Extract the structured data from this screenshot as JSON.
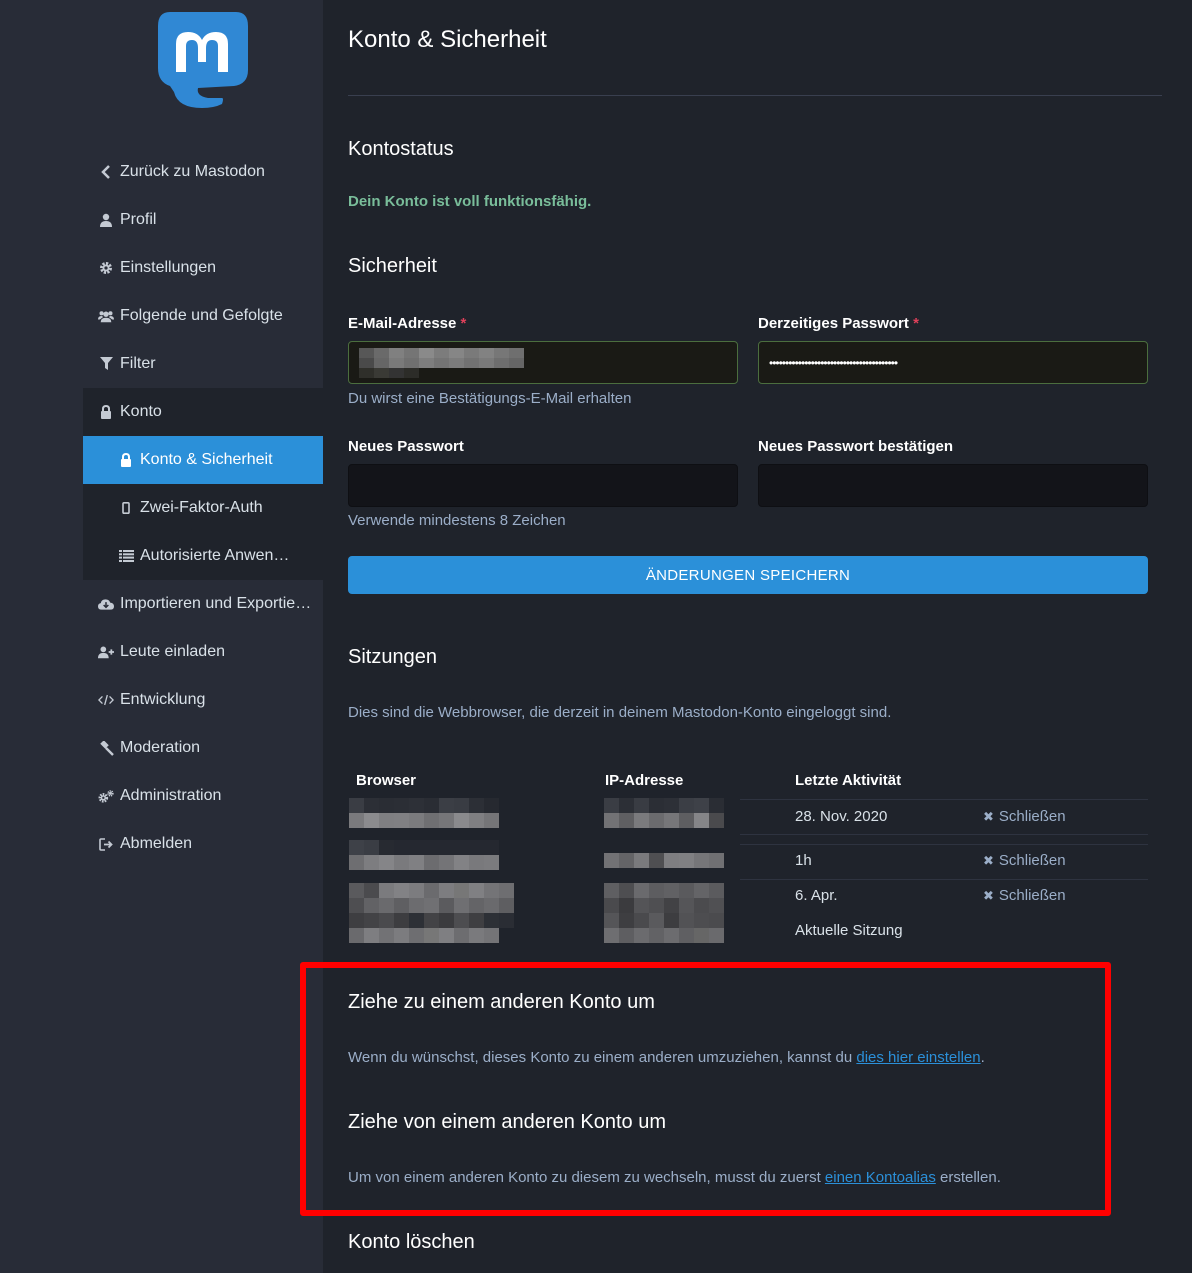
{
  "sidebar": {
    "items": [
      {
        "label": "Zurück zu Mastodon",
        "icon": "chevron-left-icon"
      },
      {
        "label": "Profil",
        "icon": "user-icon"
      },
      {
        "label": "Einstellungen",
        "icon": "gear-icon"
      },
      {
        "label": "Folgende und Gefolgte",
        "icon": "users-icon"
      },
      {
        "label": "Filter",
        "icon": "filter-icon"
      },
      {
        "label": "Konto",
        "icon": "lock-icon"
      },
      {
        "label": "Konto & Sicherheit",
        "icon": "lock-icon"
      },
      {
        "label": "Zwei-Faktor-Auth",
        "icon": "mobile-icon"
      },
      {
        "label": "Autorisierte Anwen…",
        "icon": "list-icon"
      },
      {
        "label": "Importieren und Exportie…",
        "icon": "cloud-download-icon"
      },
      {
        "label": "Leute einladen",
        "icon": "user-plus-icon"
      },
      {
        "label": "Entwicklung",
        "icon": "code-icon"
      },
      {
        "label": "Moderation",
        "icon": "gavel-icon"
      },
      {
        "label": "Administration",
        "icon": "cogs-icon"
      },
      {
        "label": "Abmelden",
        "icon": "sign-out-icon"
      }
    ]
  },
  "page": {
    "title": "Konto & Sicherheit",
    "status_heading": "Kontostatus",
    "status_text": "Dein Konto ist voll funktionsfähig.",
    "security_heading": "Sicherheit"
  },
  "form": {
    "email_label": "E-Mail-Adresse",
    "current_password_label": "Derzeitiges Passwort",
    "required_mark": "*",
    "current_password_value": "••••••••••••••••••••••••••••••••••••••••",
    "email_hint": "Du wirst eine Bestätigungs-E-Mail erhalten",
    "new_password_label": "Neues Passwort",
    "confirm_password_label": "Neues Passwort bestätigen",
    "password_hint": "Verwende mindestens 8 Zeichen",
    "save_label": "ÄNDERUNGEN SPEICHERN"
  },
  "sessions": {
    "heading": "Sitzungen",
    "intro": "Dies sind die Webbrowser, die derzeit in deinem Mastodon-Konto eingeloggt sind.",
    "columns": [
      "Browser",
      "IP-Adresse",
      "Letzte Aktivität"
    ],
    "rows": [
      {
        "last_activity": "28. Nov. 2020",
        "action": "Schließen"
      },
      {
        "last_activity": "1h",
        "action": "Schließen"
      },
      {
        "last_activity": "6. Apr.",
        "action": "Schließen"
      },
      {
        "last_activity": "Aktuelle Sitzung"
      }
    ]
  },
  "migration": {
    "move_to_heading": "Ziehe zu einem anderen Konto um",
    "move_to_text_before": "Wenn du wünschst, dieses Konto zu einem anderen umzuziehen, kannst du ",
    "move_to_link": "dies hier einstellen",
    "move_to_text_after": ".",
    "move_from_heading": "Ziehe von einem anderen Konto um",
    "move_from_text_before": "Um von einem anderen Konto zu diesem zu wechseln, musst du zuerst ",
    "move_from_link": "einen Kontoalias",
    "move_from_text_after": " erstellen."
  },
  "delete": {
    "heading": "Konto löschen"
  },
  "colors": {
    "accent": "#2b90d9",
    "success": "#79bd9a",
    "required": "#df405a",
    "highlight": "#ff0000"
  }
}
